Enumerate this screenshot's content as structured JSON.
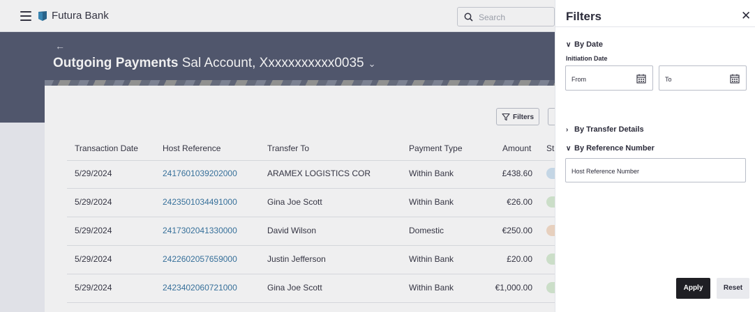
{
  "app": {
    "brand": "Futura Bank"
  },
  "search": {
    "placeholder": "Search"
  },
  "header": {
    "title_bold": "Outgoing Payments",
    "account": "Sal Account, Xxxxxxxxxxx0035",
    "back_icon": "arrow-left-icon",
    "dropdown_icon": "chevron-down-icon"
  },
  "toolbar": {
    "filters_label": "Filters"
  },
  "table": {
    "columns": [
      "Transaction Date",
      "Host Reference",
      "Transfer To",
      "Payment Type",
      "Amount",
      "St"
    ],
    "rows": [
      {
        "date": "5/29/2024",
        "ref": "2417601039202000",
        "to": "ARAMEX LOGISTICS COR",
        "type": "Within Bank",
        "amount": "£438.60",
        "status_color": "#cfe3f3"
      },
      {
        "date": "5/29/2024",
        "ref": "2423501034491000",
        "to": "Gina Joe Scott",
        "type": "Within Bank",
        "amount": "€26.00",
        "status_color": "#d6ecd2"
      },
      {
        "date": "5/29/2024",
        "ref": "2417302041330000",
        "to": "David Wilson",
        "type": "Domestic",
        "amount": "€250.00",
        "status_color": "#f6dcc6"
      },
      {
        "date": "5/29/2024",
        "ref": "2422602057659000",
        "to": "Justin Jefferson",
        "type": "Within Bank",
        "amount": "£20.00",
        "status_color": "#d6ecd2"
      },
      {
        "date": "5/29/2024",
        "ref": "2423402060721000",
        "to": "Gina Joe Scott",
        "type": "Within Bank",
        "amount": "€1,000.00",
        "status_color": "#d6ecd2"
      }
    ]
  },
  "filters_panel": {
    "title": "Filters",
    "close_icon": "close-icon",
    "by_date": "By Date",
    "initiation_date": "Initiation Date",
    "from_placeholder": "From",
    "to_placeholder": "To",
    "by_transfer_details": "By Transfer Details",
    "by_reference_number": "By Reference Number",
    "host_reference_placeholder": "Host Reference Number",
    "apply_label": "Apply",
    "reset_label": "Reset"
  }
}
